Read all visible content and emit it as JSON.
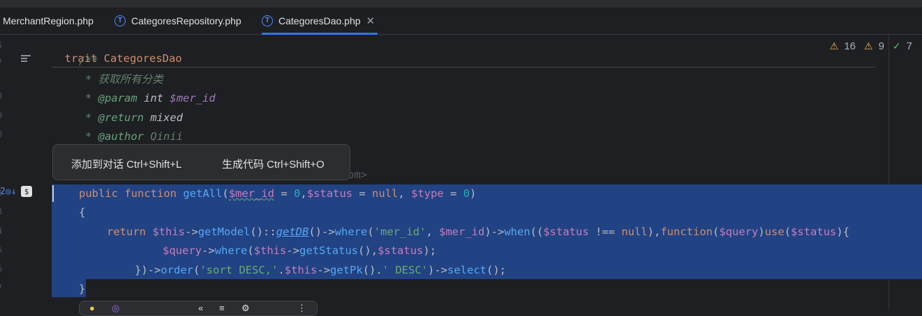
{
  "tabs": [
    {
      "label": "MerchantRegion.php",
      "icon": "php-file-icon"
    },
    {
      "label": "CategoresRepository.php",
      "icon": "trait-icon",
      "icon_letter": "T"
    },
    {
      "label": "CategoresDao.php",
      "icon": "trait-icon",
      "icon_letter": "T",
      "active": true
    }
  ],
  "editor": {
    "line_numbers": [
      "5",
      "7",
      "8",
      "9",
      "0",
      "1",
      "2",
      "3",
      "4",
      "5",
      "6",
      "7"
    ],
    "breadcrumb": "trait CategoresDao",
    "code": {
      "doc_open": "/**",
      "doc_desc": "* 获取所有分类",
      "doc_param_tag": "@param",
      "doc_param_type": "int",
      "doc_param_var": "$mer_id",
      "doc_return_tag": "@return",
      "doc_return_type": "mixed",
      "doc_author_tag": "@author",
      "doc_author_name": "Qinii",
      "hidden_fragment": "om>",
      "l1_public": "public",
      "l1_function": "function",
      "l1_name": "getAll",
      "l1_p1": "$mer_id",
      "l1_eq1": " = ",
      "l1_d1": "0",
      "l1_p2": "$status",
      "l1_eq2": " = ",
      "l1_null": "null",
      "l1_p3": "$type",
      "l1_eq3": " = ",
      "l1_d3": "0",
      "l2": "{",
      "l3_return": "return",
      "l3_this": "$this",
      "l3_getModel": "getModel",
      "l3_getDB": "getDB",
      "l3_where": "where",
      "l3_str": "'mer_id'",
      "l3_mer": "$mer_id",
      "l3_when": "when",
      "l3_status": "$status",
      "l3_op": " !== ",
      "l3_null": "null",
      "l3_function": "function",
      "l3_query": "$query",
      "l3_use": "use",
      "l3_status2": "$status",
      "l4_query": "$query",
      "l4_where": "where",
      "l4_this": "$this",
      "l4_getStatus": "getStatus",
      "l4_status": "$status",
      "l5_order": "order",
      "l5_str1": "'sort DESC,'",
      "l5_this": "$this",
      "l5_getPk": "getPk",
      "l5_str2": "' DESC'",
      "l5_select": "select",
      "l6": "}"
    }
  },
  "popup": {
    "add_to_chat": "添加到对话 Ctrl+Shift+L",
    "generate_code": "生成代码 Ctrl+Shift+O"
  },
  "inspections": {
    "warnings": "16",
    "weak_warnings": "9",
    "ok": "7"
  },
  "colors": {
    "background": "#1e1f22",
    "selection": "#214283",
    "keyword": "#cf8e6d",
    "function": "#56a8f5",
    "variable": "#c77dbb",
    "string": "#6aab73",
    "number": "#2aacb8",
    "accent": "#3574f0"
  }
}
